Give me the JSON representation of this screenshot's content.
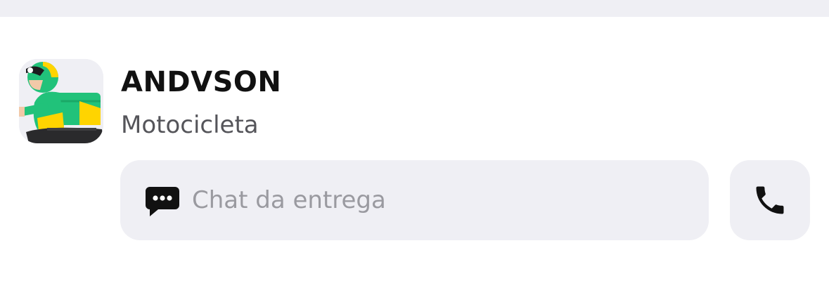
{
  "courier": {
    "name": "ANDVSON",
    "vehicle": "Motocicleta",
    "avatar_icon": "delivery-motorcyclist-icon"
  },
  "actions": {
    "chat_label": "Chat da entrega",
    "chat_icon": "chat-bubble-icon",
    "call_icon": "phone-icon"
  },
  "colors": {
    "surface": "#efeff4",
    "brand_green": "#21c27a",
    "brand_yellow": "#ffd400",
    "text_primary": "#111111",
    "text_secondary": "#55555a",
    "text_placeholder": "#9a9aa0"
  }
}
